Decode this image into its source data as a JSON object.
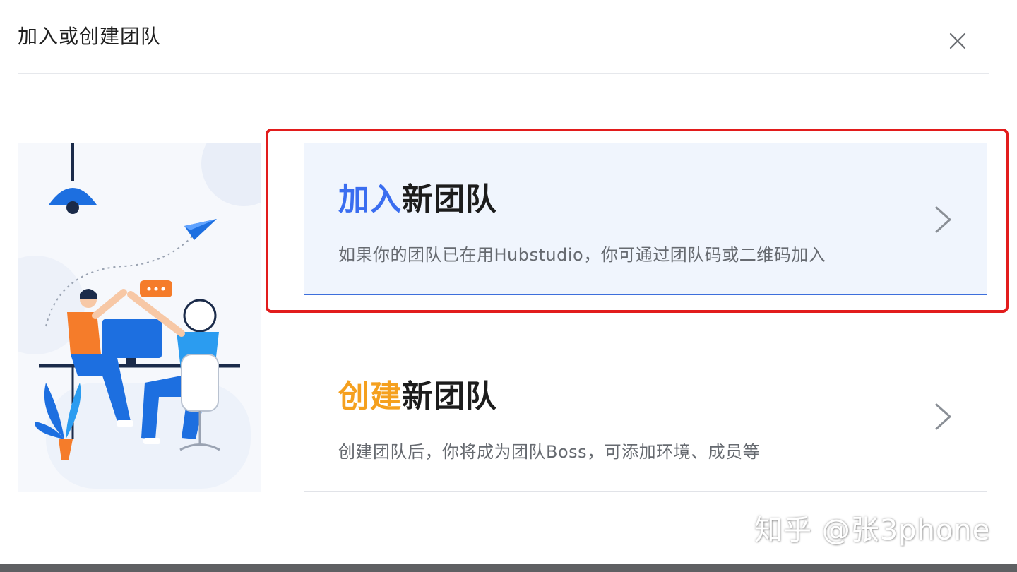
{
  "dialog": {
    "title": "加入或创建团队",
    "close_icon": "close-icon"
  },
  "options": {
    "join": {
      "heading_accent": "加入",
      "heading_rest": "新团队",
      "description": "如果你的团队已在用Hubstudio，你可通过团队码或二维码加入",
      "accent_color": "#3a6df0",
      "icon": "chevron-right-icon"
    },
    "create": {
      "heading_accent": "创建",
      "heading_rest": "新团队",
      "description": "创建团队后，你将成为团队Boss，可添加环境、成员等",
      "accent_color": "#f5a01e",
      "icon": "chevron-right-icon"
    }
  },
  "watermark": {
    "text": "知乎 @张3phone"
  },
  "colors": {
    "highlight_border": "#e21c1c",
    "selected_card_border": "#3d6fdc",
    "selected_card_bg": "#f0f5fd"
  }
}
